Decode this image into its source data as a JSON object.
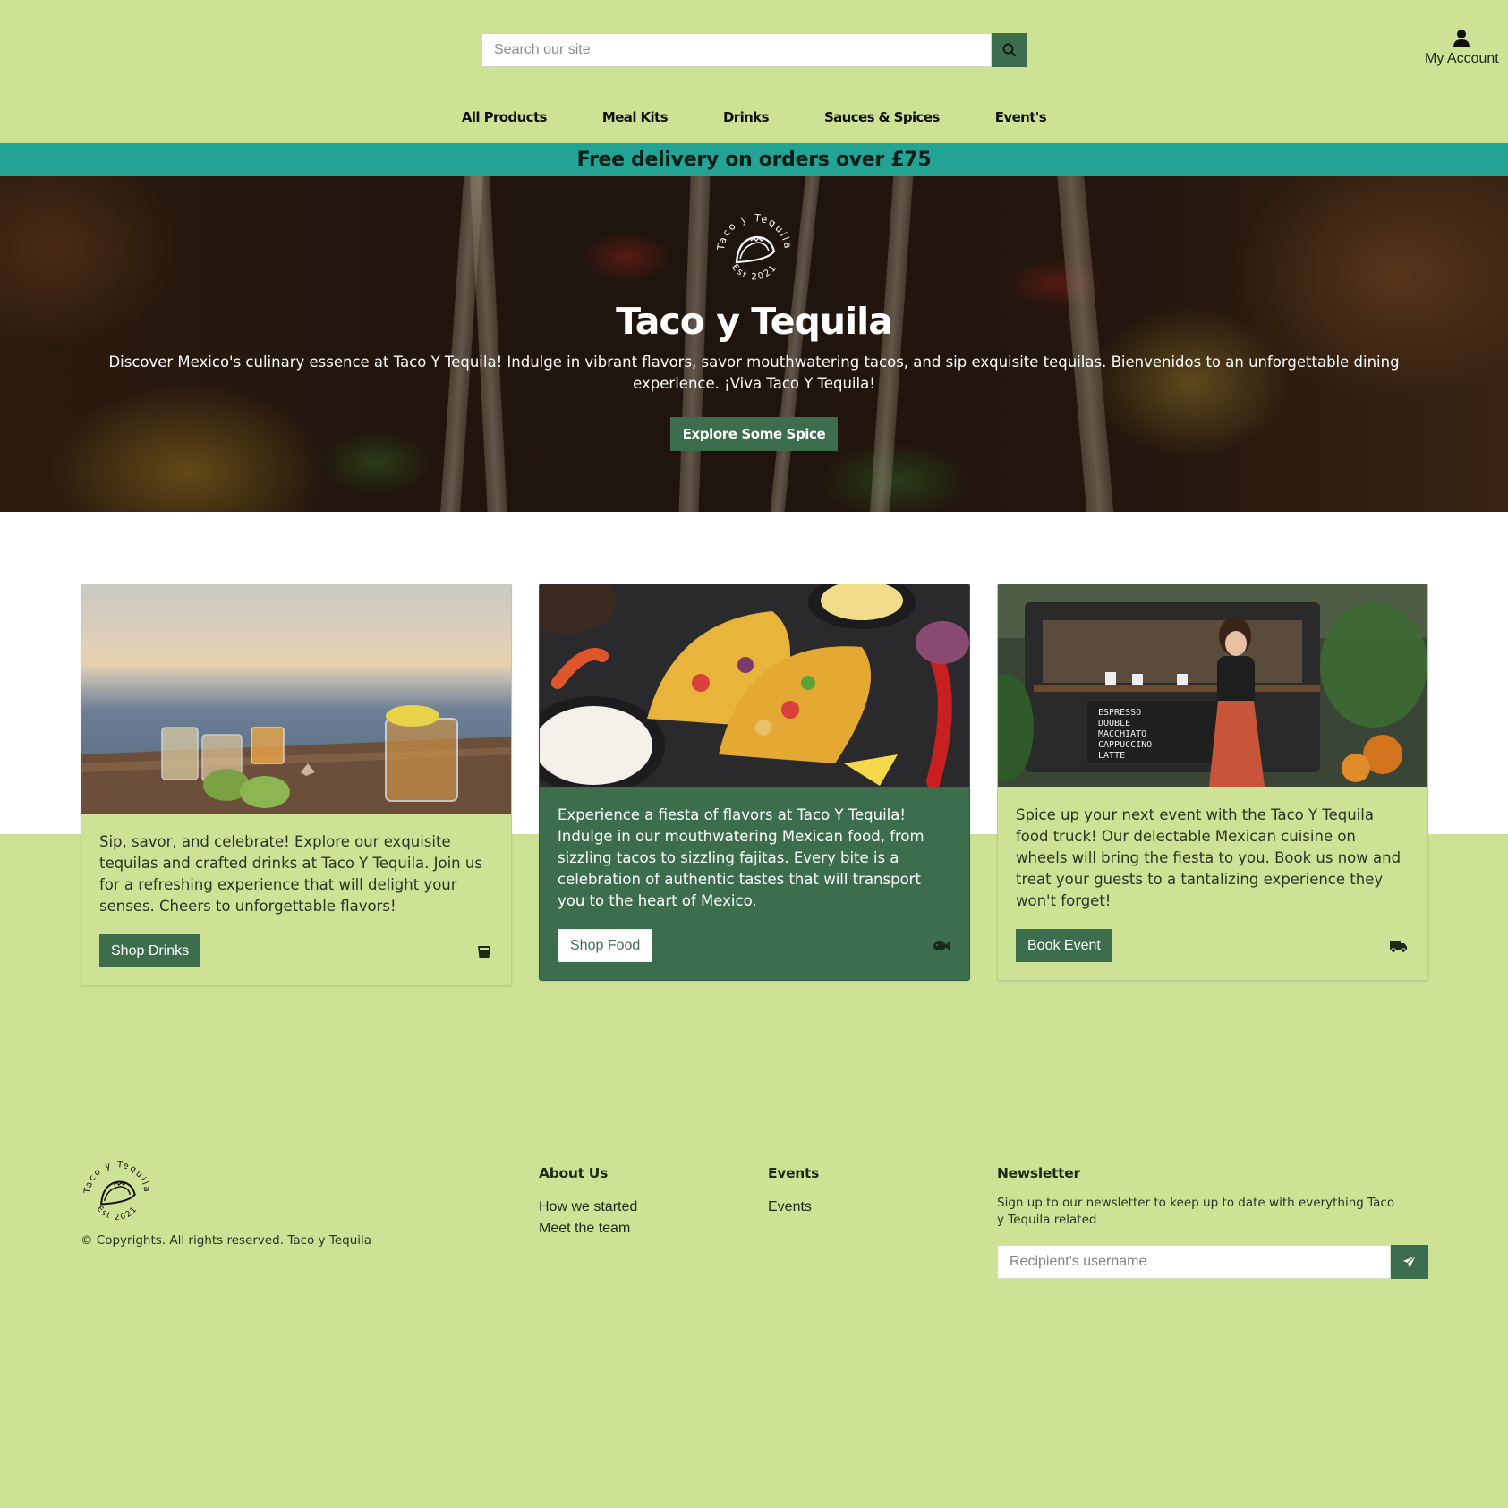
{
  "header": {
    "search": {
      "placeholder": "Search our site"
    },
    "account_label": "My Account"
  },
  "nav": {
    "items": [
      {
        "label": "All Products"
      },
      {
        "label": "Meal Kits"
      },
      {
        "label": "Drinks"
      },
      {
        "label": "Sauces & Spices"
      },
      {
        "label": "Event's"
      }
    ]
  },
  "banner": {
    "text": "Free delivery on orders over £75"
  },
  "hero": {
    "logo": {
      "top_text": "Taco y Tequila",
      "bottom_text": "Est 2021"
    },
    "title": "Taco y Tequila",
    "description": "Discover Mexico's culinary essence at Taco Y Tequila! Indulge in vibrant flavors, savor mouthwatering tacos, and sip exquisite tequilas. Bienvenidos to an unforgettable dining experience. ¡Viva Taco Y Tequila!",
    "button_label": "Explore Some Spice"
  },
  "cards": [
    {
      "text": "Sip, savor, and celebrate! Explore our exquisite tequilas and crafted drinks at Taco Y Tequila. Join us for a refreshing experience that will delight your senses. Cheers to unforgettable flavors!",
      "button_label": "Shop Drinks",
      "icon": "glass-icon"
    },
    {
      "text": "Experience a fiesta of flavors at Taco Y Tequila! Indulge in our mouthwatering Mexican food, from sizzling tacos to sizzling fajitas. Every bite is a celebration of authentic tastes that will transport you to the heart of Mexico.",
      "button_label": "Shop Food",
      "icon": "fish-icon"
    },
    {
      "text": "Spice up your next event with the Taco Y Tequila food truck! Our delectable Mexican cuisine on wheels will bring the fiesta to you. Book us now and treat your guests to a tantalizing experience they won't forget!",
      "button_label": "Book Event",
      "icon": "truck-icon",
      "chalkboard": [
        "ESPRESSO",
        "DOUBLE",
        "MACCHIATO",
        "CAPPUCCINO",
        "LATTE"
      ]
    }
  ],
  "footer": {
    "copyright": "© Copyrights. All rights reserved. Taco y Tequila",
    "about": {
      "heading": "About Us",
      "links": [
        "How we started",
        "Meet the team"
      ]
    },
    "events": {
      "heading": "Events",
      "links": [
        "Events"
      ]
    },
    "newsletter": {
      "heading": "Newsletter",
      "text": "Sign up to our newsletter to keep up to date with everything Taco y Tequila related",
      "placeholder": "Recipient's username"
    }
  },
  "colors": {
    "page_bg": "#cde294",
    "brand_green": "#3c6e4e",
    "banner_teal": "#22a394"
  }
}
